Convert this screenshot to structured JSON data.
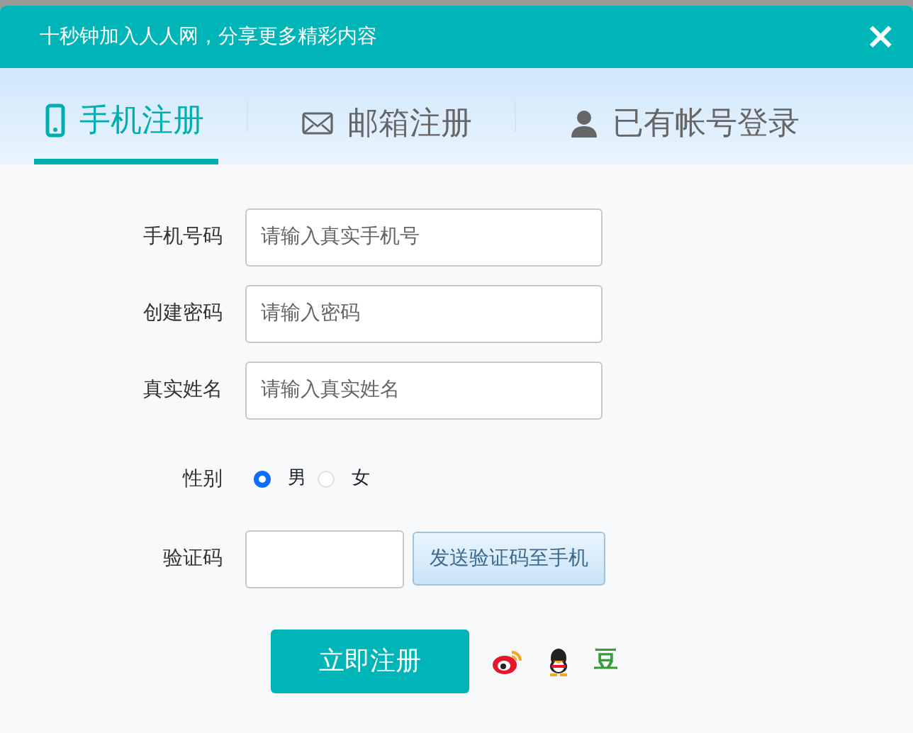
{
  "header": {
    "title": "十秒钟加入人人网，分享更多精彩内容",
    "close": "×"
  },
  "tabs": [
    {
      "kind": "phone",
      "label": "手机注册",
      "selected": true
    },
    {
      "kind": "mail",
      "label": "邮箱注册",
      "selected": false
    },
    {
      "kind": "user",
      "label": "已有帐号登录",
      "selected": false
    }
  ],
  "fields": [
    {
      "kind": "text",
      "label": "手机号码",
      "placeholder": "请输入真实手机号"
    },
    {
      "kind": "text",
      "label": "创建密码",
      "placeholder": "请输入密码"
    },
    {
      "kind": "text",
      "label": "真实姓名",
      "placeholder": "请输入真实姓名"
    },
    {
      "kind": "radio",
      "label": "性别",
      "options": [
        {
          "label": "男",
          "selected": true
        },
        {
          "label": "女",
          "selected": false
        }
      ]
    },
    {
      "kind": "captcha",
      "label": "验证码",
      "button": "发送验证码至手机"
    }
  ],
  "submit": "立即注册",
  "social": [
    {
      "kind": "weibo"
    },
    {
      "kind": "qq"
    },
    {
      "kind": "douban",
      "text": "豆"
    }
  ]
}
